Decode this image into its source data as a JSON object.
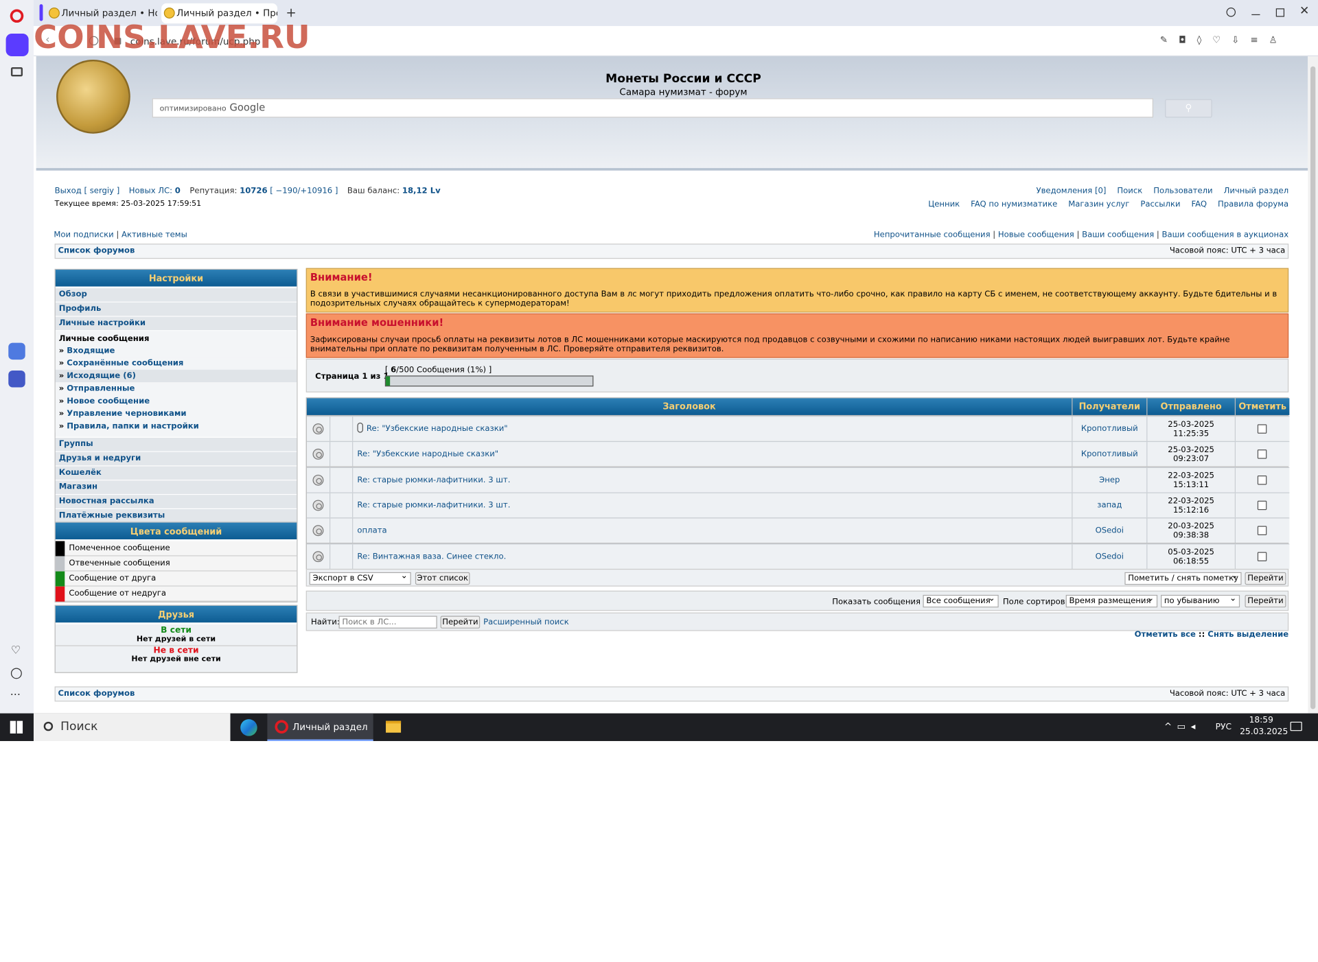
{
  "browser": {
    "tabs": [
      {
        "label": "Личный раздел • Новое"
      },
      {
        "label": "Личный раздел • Просм"
      }
    ],
    "url": "coins.lave.ru/forum/ucp.php",
    "watermark": "COINS.LAVE.RU"
  },
  "header": {
    "title": "Монеты России и СССР",
    "subtitle": "Самара нумизмат - форум",
    "search_placeholder": "оптимизировано",
    "search_brand": "Google"
  },
  "userbar": {
    "logout": "Выход [ sergiy ]",
    "new_pm_label": "Новых ЛС:",
    "new_pm_count": "0",
    "rep_label": "Репутация:",
    "rep_value": "10726",
    "rep_detail": "[ −190/+10916 ]",
    "balance_label": "Ваш баланс:",
    "balance_value": "18,12 Lv",
    "time": "Текущее время: 25-03-2025 17:59:51"
  },
  "toplinks": {
    "row1": [
      "Уведомления [0]",
      "Поиск",
      "Пользователи",
      "Личный раздел"
    ],
    "row2": [
      "Ценник",
      "FAQ по нумизматике",
      "Магазин услуг",
      "Рассылки",
      "FAQ",
      "Правила форума"
    ]
  },
  "sublinks": {
    "left": [
      "Мои подписки",
      "Активные темы"
    ],
    "right": [
      "Непрочитанные сообщения",
      "Новые сообщения",
      "Ваши сообщения",
      "Ваши сообщения в аукционах"
    ]
  },
  "breadcrumb": {
    "label": "Список форумов",
    "timezone": "Часовой пояс: UTC + 3 часа"
  },
  "menu": {
    "title": "Настройки",
    "items_top": [
      "Обзор",
      "Профиль",
      "Личные настройки"
    ],
    "pm_title": "Личные сообщения",
    "pm_items": [
      "Входящие",
      "Сохранённые сообщения",
      "Исходящие (6)",
      "Отправленные",
      "Новое сообщение",
      "Управление черновиками",
      "Правила, папки и настройки"
    ],
    "items_bottom": [
      "Группы",
      "Друзья и недруги",
      "Кошелёк",
      "Магазин",
      "Новостная рассылка",
      "Платёжные реквизиты"
    ]
  },
  "colors_panel": {
    "title": "Цвета сообщений",
    "rows": [
      {
        "label": "Помеченное сообщение",
        "color": "#000000"
      },
      {
        "label": "Отвеченные сообщения",
        "color": "#c0c4c8"
      },
      {
        "label": "Сообщение от друга",
        "color": "#138a19"
      },
      {
        "label": "Сообщение от недруга",
        "color": "#e0111a"
      }
    ]
  },
  "friends_panel": {
    "title": "Друзья",
    "online": "В сети",
    "online_none": "Нет друзей в сети",
    "offline": "Не в сети",
    "offline_none": "Нет друзей вне сети"
  },
  "alerts": [
    {
      "title": "Внимание!",
      "text": "В связи в участившимися случаями несанкционированного доступа Вам в лс могут приходить предложения оплатить что-либо срочно, как правило на карту СБ с именем, не соответствующему аккаунту. Будьте бдительны и в подозрительных случаях обращайтесь к супермодераторам!"
    },
    {
      "title": "Внимание мошенники!",
      "text": "Зафиксированы случаи просьб оплаты на реквизиты лотов в ЛС мошенниками которые маскируются под продавцов с созвучными и схожими по написанию никами настоящих людей выигравших лот. Будьте крайне внимательны при оплате по реквизитам полученным в ЛС. Проверяйте отправителя реквизитов."
    }
  ],
  "pager": {
    "page": "Страница 1 из 1",
    "count_used": "6",
    "count_text": "/500 Сообщения (1%) ]",
    "count_prefix": "[ ",
    "fill_percent": 1
  },
  "table": {
    "headers": [
      "Заголовок",
      "Получатели",
      "Отправлено",
      "Отметить"
    ],
    "rows": [
      {
        "title": "Re: \"Узбекские народные сказки\"",
        "attach": true,
        "to": "Кропотливый",
        "date": "25-03-2025",
        "time": "11:25:35"
      },
      {
        "title": "Re: \"Узбекские народные сказки\"",
        "attach": false,
        "to": "Кропотливый",
        "date": "25-03-2025",
        "time": "09:23:07"
      },
      {
        "title": "Re: старые рюмки-лафитники. 3 шт.",
        "attach": false,
        "to": "Энер",
        "date": "22-03-2025",
        "time": "15:13:11"
      },
      {
        "title": "Re: старые рюмки-лафитники. 3 шт.",
        "attach": false,
        "to": "запад",
        "date": "22-03-2025",
        "time": "15:12:16"
      },
      {
        "title": "оплата",
        "attach": false,
        "to": "OSedoi",
        "date": "20-03-2025",
        "time": "09:38:38"
      },
      {
        "title": "Re: Винтажная ваза. Синее стекло.",
        "attach": false,
        "to": "OSedoi",
        "date": "05-03-2025",
        "time": "06:18:55"
      }
    ]
  },
  "actions": {
    "export_select": "Экспорт в CSV",
    "this_list": "Этот список",
    "mark_select": "Пометить / снять пометку",
    "go": "Перейти",
    "show_label": "Показать сообщения за:",
    "show_select": "Все сообщения",
    "sort_label": "Поле сортировки",
    "sort_select": "Время размещения",
    "order_select": "по убыванию",
    "find_label": "Найти:",
    "find_placeholder": "Поиск в ЛС...",
    "adv_search": "Расширенный поиск",
    "mark_all": "Отметить все",
    "unmark": "Снять выделение"
  },
  "taskbar": {
    "search": "Поиск",
    "task": "Личный раздел • ...",
    "lang": "РУС",
    "time": "18:59",
    "date": "25.03.2025"
  }
}
